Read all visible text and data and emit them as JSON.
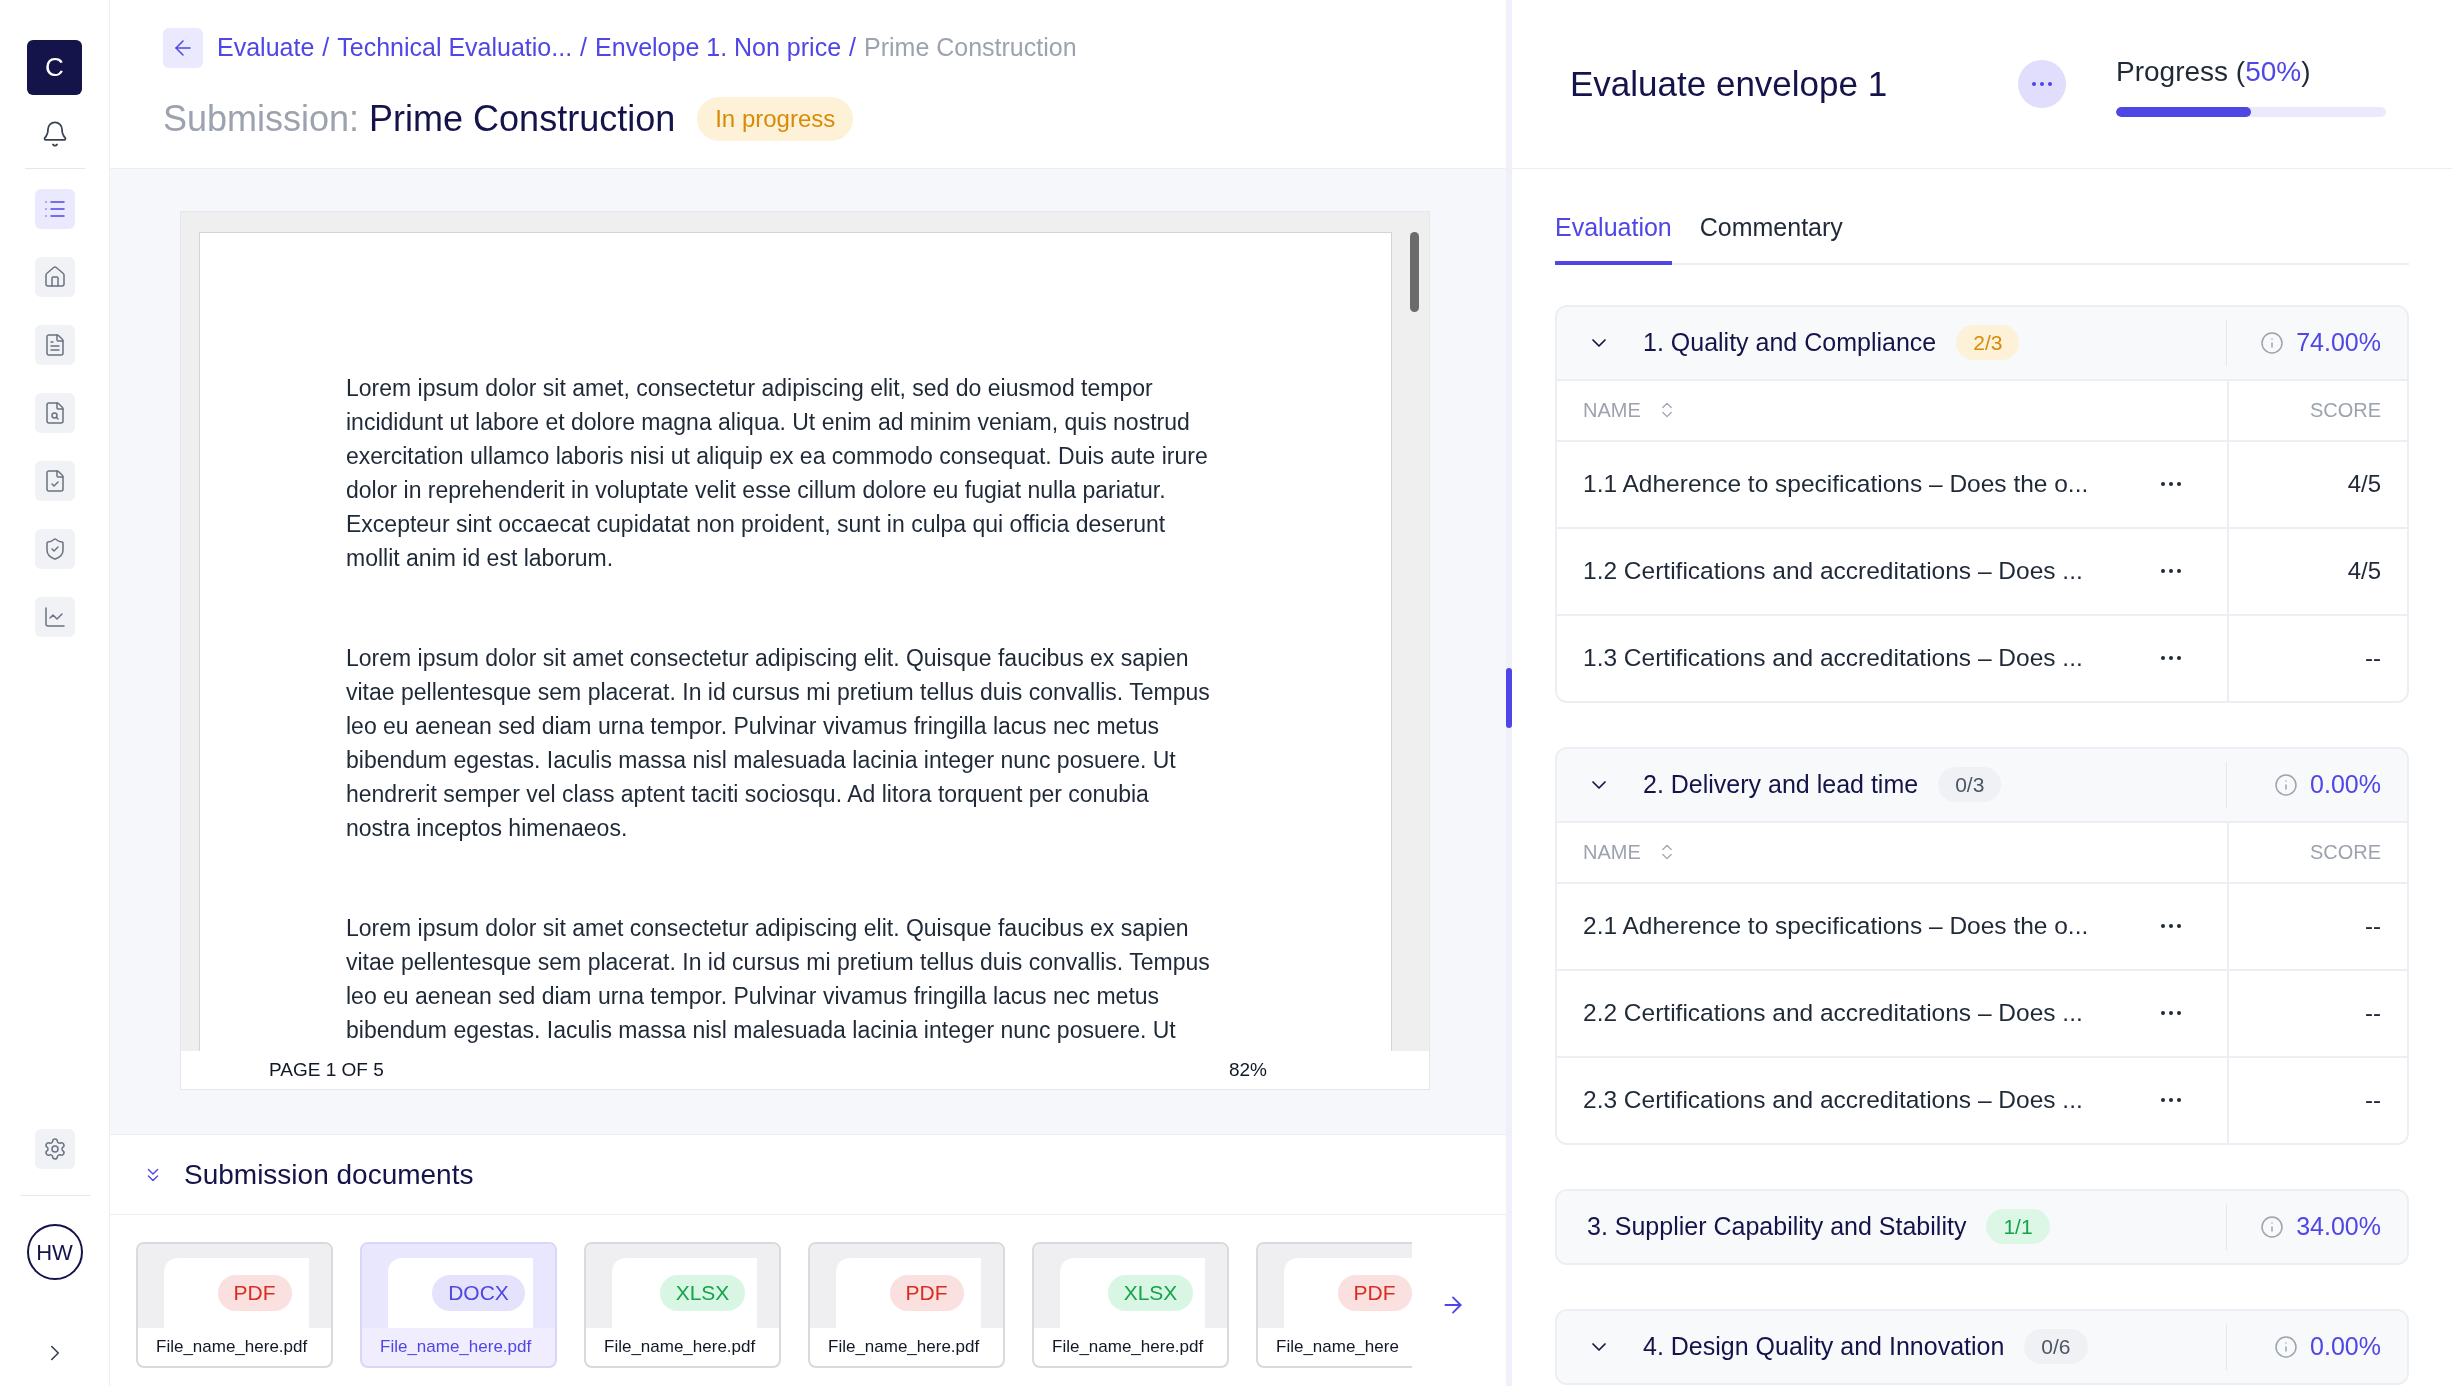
{
  "sidebar": {
    "logo": "C",
    "nav": [
      {
        "selected": true
      },
      {
        "selected": false
      },
      {
        "selected": false
      },
      {
        "selected": false
      },
      {
        "selected": false
      },
      {
        "selected": false
      },
      {
        "selected": false
      }
    ],
    "avatar": "HW"
  },
  "breadcrumb": [
    {
      "kind": "link",
      "text": "Evaluate"
    },
    {
      "kind": "separator",
      "text": "/"
    },
    {
      "kind": "link",
      "text": "Technical Evaluatio..."
    },
    {
      "kind": "separator",
      "text": "/"
    },
    {
      "kind": "link",
      "text": "Envelope 1. Non price"
    },
    {
      "kind": "separator",
      "text": "/"
    },
    {
      "kind": "current",
      "text": "Prime Construction"
    }
  ],
  "submission": {
    "label": "Submission:",
    "name": "Prime Construction",
    "status": "In progress"
  },
  "viewer": {
    "paragraphs": [
      "Lorem ipsum dolor sit amet, consectetur adipiscing elit, sed do eiusmod tempor incididunt ut labore et dolore magna aliqua. Ut enim ad minim veniam, quis nostrud exercitation ullamco laboris nisi ut aliquip ex ea commodo consequat. Duis aute irure dolor in reprehenderit in voluptate velit esse cillum dolore eu fugiat nulla pariatur. Excepteur sint occaecat cupidatat non proident, sunt in culpa qui officia deserunt mollit anim id est laborum.",
      "Lorem ipsum dolor sit amet consectetur adipiscing elit. Quisque faucibus ex sapien vitae pellentesque sem placerat. In id cursus mi pretium tellus duis convallis. Tempus leo eu aenean sed diam urna tempor. Pulvinar vivamus fringilla lacus nec metus bibendum egestas. Iaculis massa nisl malesuada lacinia integer nunc posuere. Ut hendrerit semper vel class aptent taciti sociosqu. Ad litora torquent per conubia nostra inceptos himenaeos.",
      "Lorem ipsum dolor sit amet consectetur adipiscing elit. Quisque faucibus ex sapien vitae pellentesque sem placerat. In id cursus mi pretium tellus duis convallis. Tempus leo eu aenean sed diam urna tempor. Pulvinar vivamus fringilla lacus nec metus bibendum egestas. Iaculis massa nisl malesuada lacinia integer nunc posuere. Ut"
    ],
    "page": "PAGE 1 OF 5",
    "zoom": "82%"
  },
  "documents": {
    "title": "Submission documents",
    "files": [
      {
        "kind": "pdf",
        "type": "PDF",
        "name": "File_name_here.pdf",
        "selected": false
      },
      {
        "kind": "docx",
        "type": "DOCX",
        "name": "File_name_here.pdf",
        "selected": true
      },
      {
        "kind": "xlsx",
        "type": "XLSX",
        "name": "File_name_here.pdf",
        "selected": false
      },
      {
        "kind": "pdf",
        "type": "PDF",
        "name": "File_name_here.pdf",
        "selected": false
      },
      {
        "kind": "xlsx",
        "type": "XLSX",
        "name": "File_name_here.pdf",
        "selected": false
      },
      {
        "kind": "pdf",
        "type": "PDF",
        "name": "File_name_here",
        "selected": false
      }
    ]
  },
  "panel": {
    "title": "Evaluate envelope 1",
    "progress": {
      "prefix": "Progress (",
      "value": "50%",
      "suffix": ")",
      "level": 0.5
    }
  },
  "tabs": [
    {
      "label": "Evaluation",
      "selected": true
    },
    {
      "label": "Commentary",
      "selected": false
    }
  ],
  "sections": [
    {
      "title": "1. Quality and Compliance",
      "count": "2/3",
      "kind": "partial",
      "score": "74.00%",
      "expanded": true,
      "columns": [
        "NAME",
        "SCORE"
      ],
      "rows": [
        {
          "name": "1.1 Adherence to specifications – Does the o...",
          "score": "4/5"
        },
        {
          "name": "1.2 Certifications and accreditations – Does ...",
          "score": "4/5"
        },
        {
          "name": "1.3 Certifications and accreditations – Does ...",
          "score": "--"
        }
      ]
    },
    {
      "title": "2. Delivery and lead time",
      "count": "0/3",
      "kind": "empty",
      "score": "0.00%",
      "expanded": true,
      "columns": [
        "NAME",
        "SCORE"
      ],
      "rows": [
        {
          "name": "2.1 Adherence to specifications – Does the o...",
          "score": "--"
        },
        {
          "name": "2.2 Certifications and accreditations – Does ...",
          "score": "--"
        },
        {
          "name": "2.3 Certifications and accreditations – Does ...",
          "score": "--"
        }
      ]
    },
    {
      "title": "3. Supplier Capability and Stability",
      "count": "1/1",
      "kind": "complete",
      "score": "34.00%",
      "expanded": false
    },
    {
      "title": "4. Design Quality and Innovation",
      "count": "0/6",
      "kind": "empty",
      "score": "0.00%",
      "expanded": true
    }
  ]
}
